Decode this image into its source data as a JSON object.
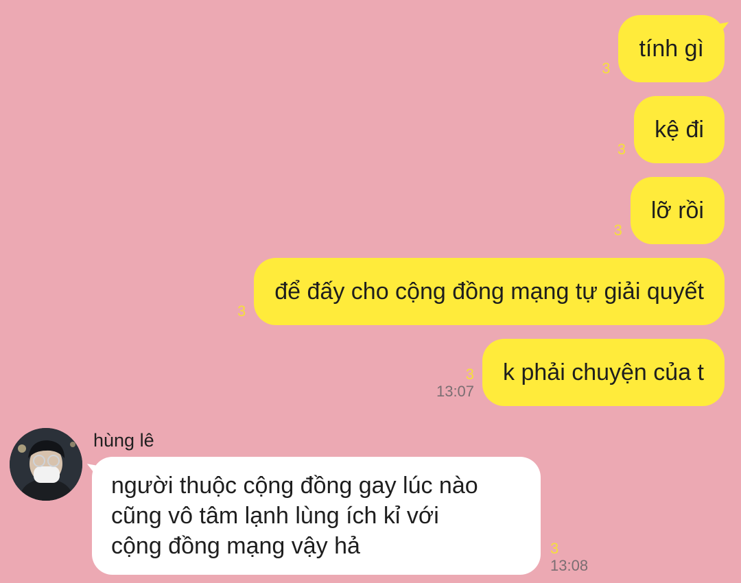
{
  "messages_out": [
    {
      "text": "tính gì",
      "unread": "3",
      "time": ""
    },
    {
      "text": "kệ đi",
      "unread": "3",
      "time": ""
    },
    {
      "text": "lỡ rồi",
      "unread": "3",
      "time": ""
    },
    {
      "text": "để đấy cho cộng đồng mạng tự giải quyết",
      "unread": "3",
      "time": ""
    },
    {
      "text": "k phải chuyện của t",
      "unread": "3",
      "time": "13:07"
    }
  ],
  "message_in": {
    "sender": "hùng lê",
    "lines": [
      "người thuộc cộng đồng gay lúc nào",
      "cũng vô tâm lạnh lùng ích kỉ với",
      "cộng đồng mạng vậy hả"
    ],
    "unread": "3",
    "time": "13:08"
  },
  "colors": {
    "background": "#eca9b3",
    "outgoing_bubble": "#ffeb3b",
    "incoming_bubble": "#ffffff",
    "unread_count": "#f5df3b"
  }
}
